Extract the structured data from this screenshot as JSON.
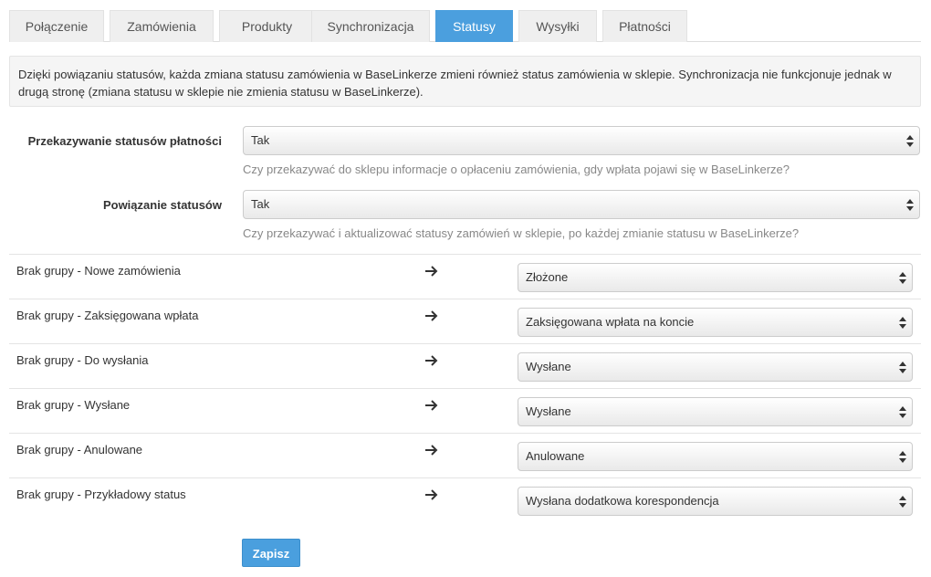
{
  "tabs": [
    {
      "label": "Połączenie",
      "active": false
    },
    {
      "label": "Zamówienia",
      "active": false
    },
    {
      "label": "Produkty",
      "active": false
    },
    {
      "label": "Synchronizacja",
      "active": false
    },
    {
      "label": "Statusy",
      "active": true
    },
    {
      "label": "Wysyłki",
      "active": false
    },
    {
      "label": "Płatności",
      "active": false
    }
  ],
  "info": {
    "text": "Dzięki powiązaniu statusów, każda zmiana statusu zamówienia w BaseLinkerze zmieni również status zamówienia w sklepie. Synchronizacja nie funkcjonuje jednak w drugą stronę (zmiana statusu w sklepie nie zmienia statusu w BaseLinkerze)."
  },
  "payment_status": {
    "label": "Przekazywanie statusów płatności",
    "value": "Tak",
    "help": "Czy przekazywać do sklepu informacje o opłaceniu zamówienia, gdy wpłata pojawi się w BaseLinkerze?"
  },
  "status_binding": {
    "label": "Powiązanie statusów",
    "value": "Tak",
    "help": "Czy przekazywać i aktualizować statusy zamówień w sklepie, po każdej zmianie statusu w BaseLinkerze?"
  },
  "mappings": [
    {
      "source": "Brak grupy - Nowe zamówienia",
      "target": "Złożone"
    },
    {
      "source": "Brak grupy - Zaksięgowana wpłata",
      "target": "Zaksięgowana wpłata na koncie"
    },
    {
      "source": "Brak grupy - Do wysłania",
      "target": "Wysłane"
    },
    {
      "source": "Brak grupy - Wysłane",
      "target": "Wysłane"
    },
    {
      "source": "Brak grupy - Anulowane",
      "target": "Anulowane"
    },
    {
      "source": "Brak grupy - Przykładowy status",
      "target": "Wysłana dodatkowa korespondencja"
    }
  ],
  "save_button": {
    "label": "Zapisz"
  },
  "colors": {
    "accent": "#4b9fde",
    "tab_bg": "#efefef",
    "info_bg": "#f5f5f5"
  }
}
